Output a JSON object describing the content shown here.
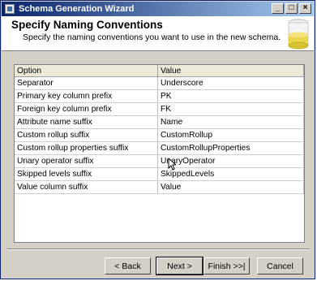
{
  "window": {
    "title": "Schema Generation Wizard"
  },
  "header": {
    "title": "Specify Naming Conventions",
    "subtitle": "Specify the naming conventions you want to use in the new schema."
  },
  "grid": {
    "columns": [
      "Option",
      "Value"
    ],
    "rows": [
      {
        "option": "Separator",
        "value": "Underscore"
      },
      {
        "option": "Primary key column prefix",
        "value": "PK"
      },
      {
        "option": "Foreign key column prefix",
        "value": "FK"
      },
      {
        "option": "Attribute name suffix",
        "value": "Name"
      },
      {
        "option": "Custom rollup suffix",
        "value": "CustomRollup"
      },
      {
        "option": "Custom rollup properties suffix",
        "value": "CustomRollupProperties"
      },
      {
        "option": "Unary operator suffix",
        "value": "UnaryOperator"
      },
      {
        "option": "Skipped levels suffix",
        "value": "SkippedLevels"
      },
      {
        "option": "Value column suffix",
        "value": "Value"
      }
    ]
  },
  "buttons": {
    "back": "< Back",
    "next": "Next >",
    "finish": "Finish >>|",
    "cancel": "Cancel"
  },
  "colors": {
    "titlebar_start": "#0a246a",
    "titlebar_end": "#a6caf0"
  }
}
